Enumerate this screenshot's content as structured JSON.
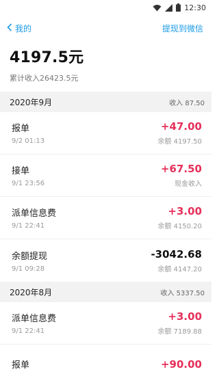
{
  "status_bar": {
    "time": "12:30"
  },
  "nav": {
    "back_label": "我的",
    "action_label": "提现到微信"
  },
  "summary": {
    "balance": "4197.5元",
    "cumulative_income": "累计收入26423.5元"
  },
  "sections": [
    {
      "title": "2020年9月",
      "income": "收入 87.50",
      "transactions": [
        {
          "title": "报单",
          "time": "9/2 01:13",
          "amount": "+47.00",
          "note": "余额 4197.50"
        },
        {
          "title": "接单",
          "time": "9/1 23:56",
          "amount": "+67.50",
          "note": "现金收入"
        },
        {
          "title": "派单信息费",
          "time": "9/1 22:41",
          "amount": "+3.00",
          "note": "余额 4150.20"
        },
        {
          "title": "余额提现",
          "time": "9/1 09:28",
          "amount": "-3042.68",
          "note": "余额 4147.20"
        }
      ]
    },
    {
      "title": "2020年8月",
      "income": "收入 5337.50",
      "transactions": [
        {
          "title": "派单信息费",
          "time": "9/1 22:41",
          "amount": "+3.00",
          "note": "余额 7189.88"
        },
        {
          "title": "报单",
          "time": "",
          "amount": "+90.00",
          "note": ""
        }
      ]
    }
  ],
  "colors": {
    "accent": "#1a9be6",
    "positive": "#e5305a",
    "negative": "#111111",
    "section_bg": "#f2f2f2"
  },
  "icons": {
    "wifi": "wifi-icon",
    "signal": "signal-icon",
    "battery": "battery-icon",
    "back": "chevron-left-icon"
  }
}
